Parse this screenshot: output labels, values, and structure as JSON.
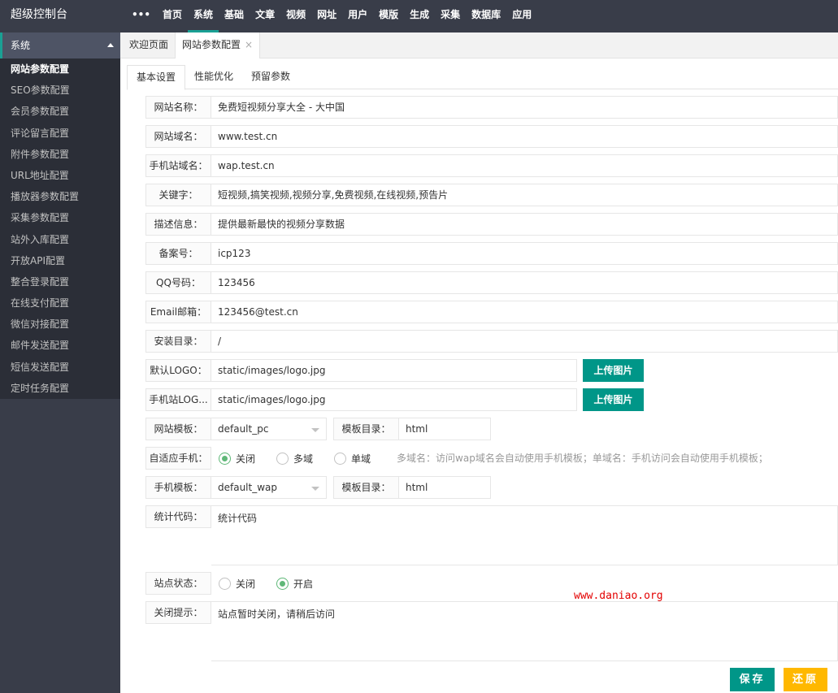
{
  "app_title": "超级控制台",
  "nav": {
    "more_icon": "•••",
    "items": [
      "首页",
      "系统",
      "基础",
      "文章",
      "视频",
      "网址",
      "用户",
      "模版",
      "生成",
      "采集",
      "数据库",
      "应用"
    ],
    "active": "系统"
  },
  "sidebar": {
    "group": "系统",
    "items": [
      "网站参数配置",
      "SEO参数配置",
      "会员参数配置",
      "评论留言配置",
      "附件参数配置",
      "URL地址配置",
      "播放器参数配置",
      "采集参数配置",
      "站外入库配置",
      "开放API配置",
      "整合登录配置",
      "在线支付配置",
      "微信对接配置",
      "邮件发送配置",
      "短信发送配置",
      "定时任务配置"
    ]
  },
  "tabs": {
    "welcome": "欢迎页面",
    "current": "网站参数配置",
    "close_icon": "×"
  },
  "subtabs": [
    "基本设置",
    "性能优化",
    "预留参数"
  ],
  "form": {
    "site_name": {
      "label": "网站名称：",
      "value": "免费短视频分享大全 - 大中国"
    },
    "site_domain": {
      "label": "网站域名：",
      "value": "www.test.cn"
    },
    "mobile_domain": {
      "label": "手机站域名：",
      "value": "wap.test.cn"
    },
    "keywords": {
      "label": "关键字：",
      "value": "短视频,搞笑视频,视频分享,免费视频,在线视频,预告片"
    },
    "description": {
      "label": "描述信息：",
      "value": "提供最新最快的视频分享数据"
    },
    "icp": {
      "label": "备案号：",
      "value": "icp123"
    },
    "qq": {
      "label": "QQ号码：",
      "value": "123456"
    },
    "email": {
      "label": "Email邮箱：",
      "value": "123456@test.cn"
    },
    "install_dir": {
      "label": "安装目录：",
      "value": "/"
    },
    "logo": {
      "label": "默认LOGO：",
      "value": "static/images/logo.jpg",
      "button": "上传图片"
    },
    "mobile_logo": {
      "label": "手机站LOG...",
      "value": "static/images/logo.jpg",
      "button": "上传图片"
    },
    "template": {
      "label": "网站模板：",
      "value": "default_pc",
      "dir_label": "模板目录：",
      "dir_value": "html"
    },
    "adaptive": {
      "label": "自适应手机：",
      "options": [
        "关闭",
        "多域",
        "单域"
      ],
      "selected": 0,
      "hint": "多域名：访问wap域名会自动使用手机模板；单域名：手机访问会自动使用手机模板；"
    },
    "mobile_template": {
      "label": "手机模板：",
      "value": "default_wap",
      "dir_label": "模板目录：",
      "dir_value": "html"
    },
    "stats_code": {
      "label": "统计代码：",
      "value": "统计代码"
    },
    "site_status": {
      "label": "站点状态：",
      "options": [
        "关闭",
        "开启"
      ],
      "selected": 1
    },
    "close_tip": {
      "label": "关闭提示：",
      "value": "站点暂时关闭，请稍后访问"
    }
  },
  "watermark": "www.daniao.org",
  "actions": {
    "save": "保存",
    "reset": "还原"
  },
  "colors": {
    "topbar": "#393d49",
    "sidebar": "#2b2e37",
    "accent": "#009688",
    "reset": "#ffb800",
    "radio_on": "#5fb878"
  }
}
